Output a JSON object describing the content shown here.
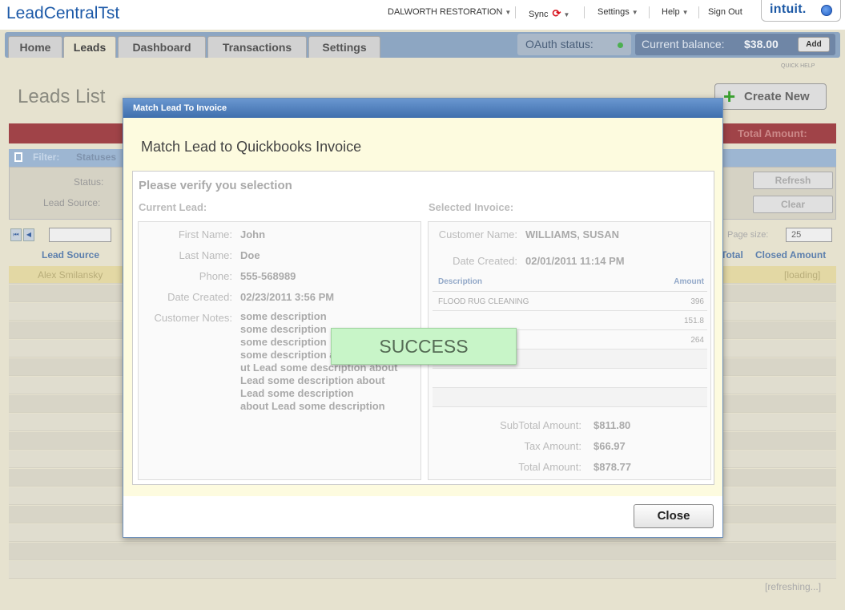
{
  "topbar": {
    "app_title": "LeadCentralTst",
    "company": "DALWORTH RESTORATION",
    "sync": "Sync",
    "settings": "Settings",
    "help": "Help",
    "sign_out": "Sign Out",
    "intuit_logo": "intuit."
  },
  "tabs": [
    "Home",
    "Leads",
    "Dashboard",
    "Transactions",
    "Settings"
  ],
  "status": {
    "oauth_label": "OAuth status:",
    "balance_label": "Current balance:",
    "balance_value": "$38.00",
    "add_label": "Add",
    "quick_help": "QUICK HELP"
  },
  "page": {
    "heading": "Leads List",
    "create_new": "Create New",
    "total_amount_label": "Total Amount:",
    "filter_label": "Filter:",
    "filter_value": "Statuses",
    "status_label": "Status:",
    "lead_source_label": "Lead Source:",
    "refresh_label": "Refresh",
    "clear_label": "Clear",
    "page_size_label": "Page size:",
    "page_size_value": "25",
    "col_lead_source": "Lead Source",
    "col_total": "Total",
    "col_closed_amount": "Closed Amount",
    "row1_source": "Alex Smilansky",
    "row1_closed": "[loading]",
    "refreshing": "[refreshing...]"
  },
  "modal": {
    "title": "Match Lead To Invoice",
    "heading": "Match Lead to Quickbooks Invoice",
    "verify_title": "Please verify you selection",
    "current_lead_title": "Current Lead:",
    "selected_invoice_title": "Selected Invoice:",
    "lead": {
      "first_name_label": "First Name:",
      "first_name": "John",
      "last_name_label": "Last Name:",
      "last_name": "Doe",
      "phone_label": "Phone:",
      "phone": "555-568989",
      "date_created_label": "Date Created:",
      "date_created": "02/23/2011 3:56 PM",
      "notes_label": "Customer Notes:",
      "notes": [
        "some description",
        "some description",
        "some description",
        "some description abo",
        "ut Lead some description about",
        "Lead some description about",
        "Lead some description",
        "about Lead some description"
      ]
    },
    "invoice": {
      "customer_name_label": "Customer Name:",
      "customer_name": "WILLIAMS, SUSAN",
      "date_created_label": "Date Created:",
      "date_created": "02/01/2011 11:14 PM",
      "col_description": "Description",
      "col_amount": "Amount",
      "lines": [
        {
          "description": "FLOOD RUG CLEANING",
          "amount": "396"
        },
        {
          "description": "",
          "amount": "151.8"
        },
        {
          "description": "",
          "amount": "264"
        }
      ],
      "subtotal_label": "SubTotal Amount:",
      "subtotal": "$811.80",
      "tax_label": "Tax Amount:",
      "tax": "$66.97",
      "total_label": "Total Amount:",
      "total": "$878.77"
    },
    "success": "SUCCESS",
    "close_label": "Close"
  }
}
